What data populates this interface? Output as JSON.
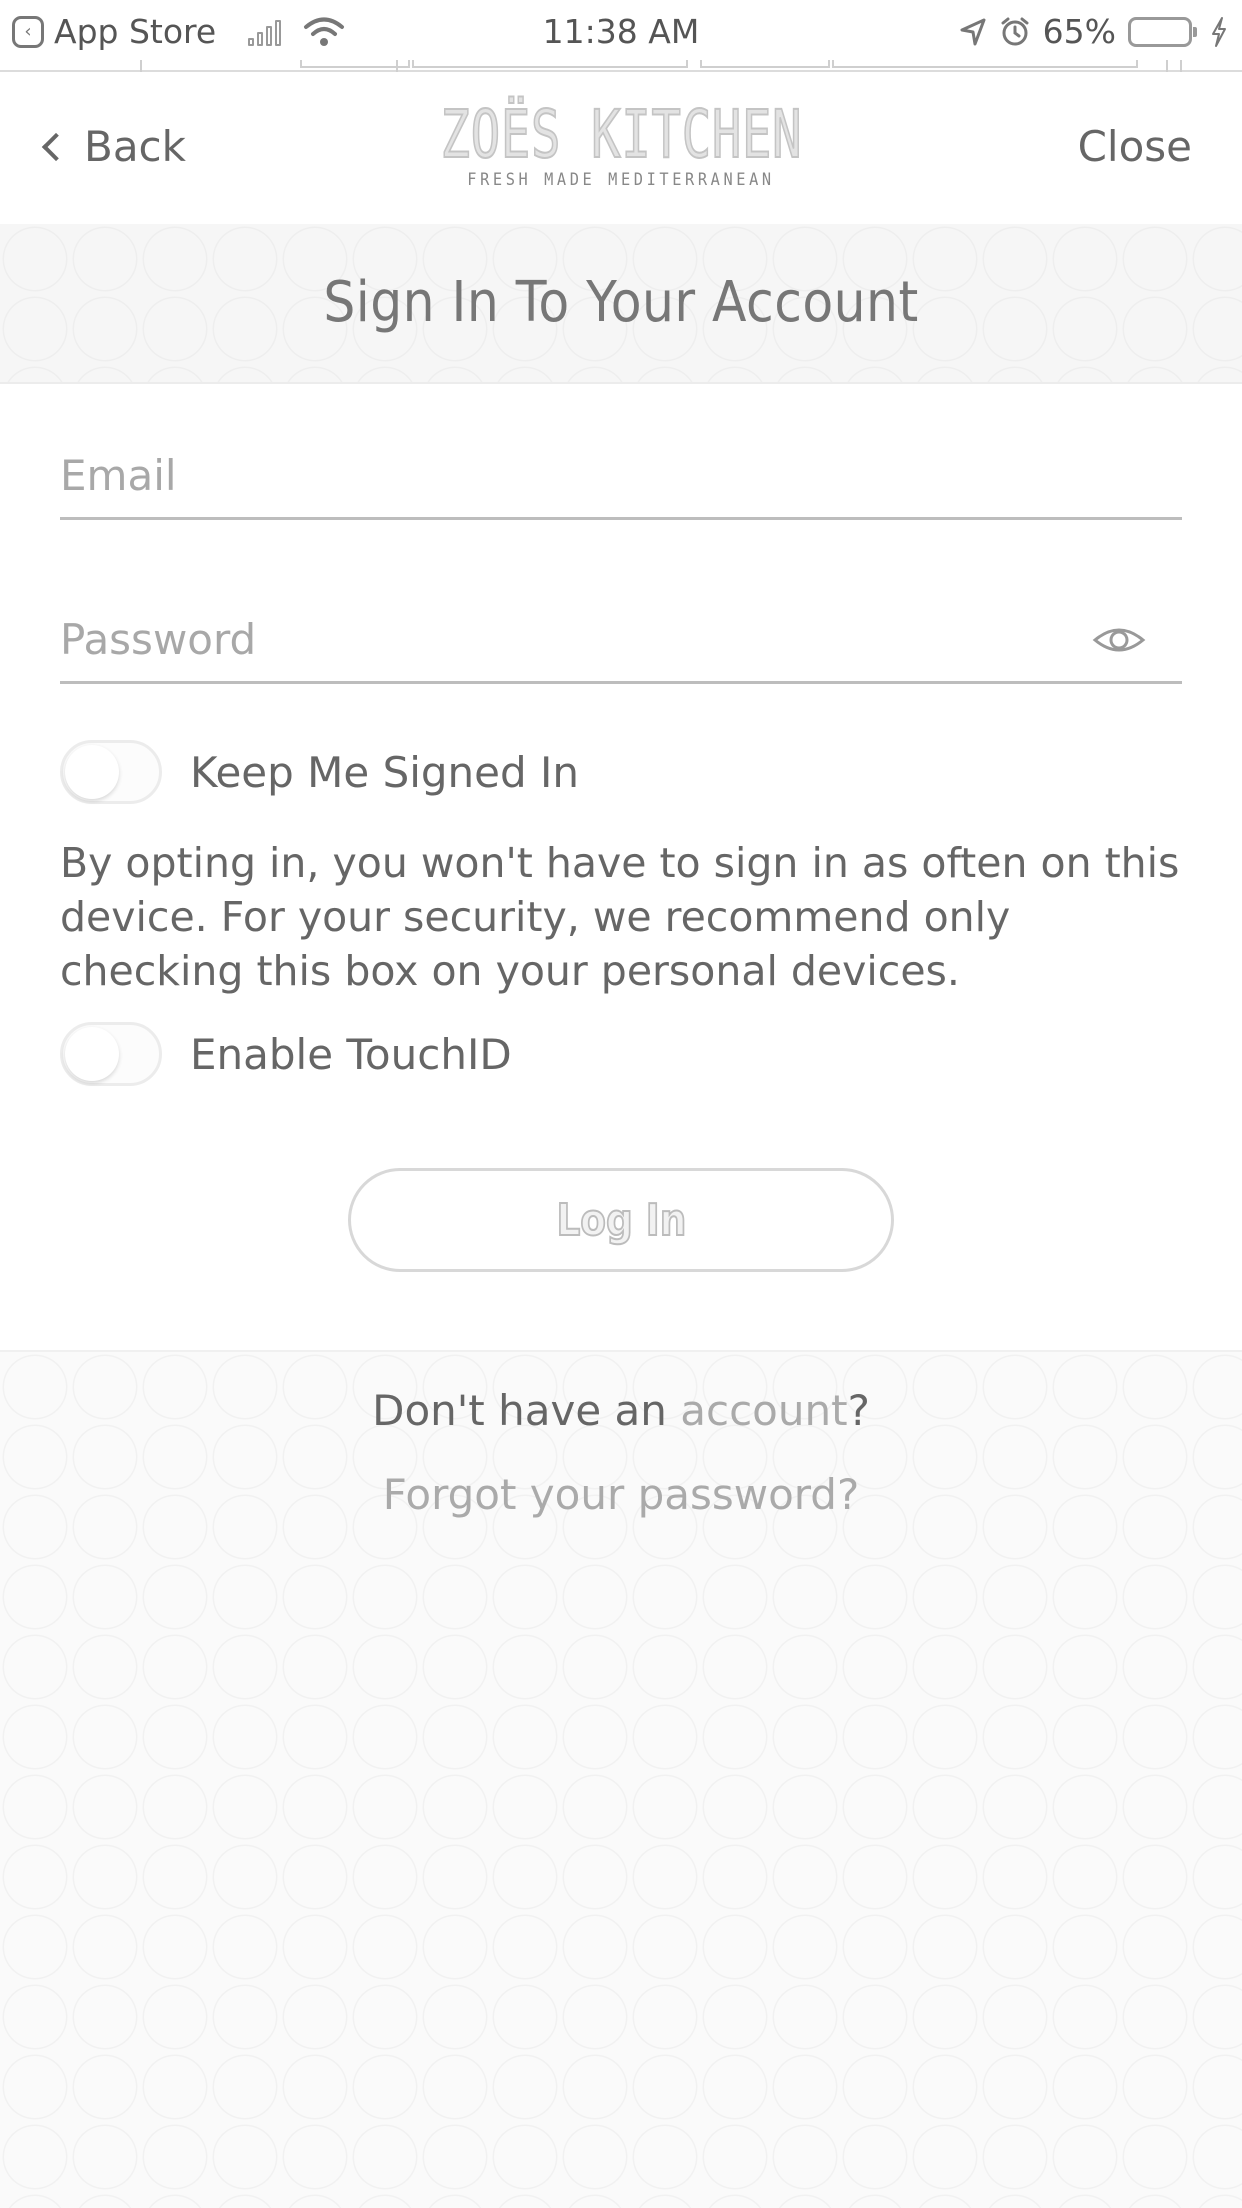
{
  "status_bar": {
    "back_app": "App Store",
    "time": "11:38 AM",
    "battery": "65%"
  },
  "nav": {
    "back_label": "Back",
    "close_label": "Close",
    "logo_name": "ZOËS KITCHEN",
    "logo_tagline": "FRESH MADE MEDITERRANEAN"
  },
  "title": "Sign In To Your Account",
  "form": {
    "email_placeholder": "Email",
    "email_value": "",
    "password_placeholder": "Password",
    "password_value": "",
    "keep_signed_in": {
      "label": "Keep Me Signed In",
      "on": false
    },
    "opt_in_note": "By opting in, you won't have to sign in as often on this device. For your security, we recommend only checking this box on your personal devices.",
    "touch_id": {
      "label": "Enable TouchID",
      "on": false
    },
    "login_label": "Log In"
  },
  "footer": {
    "signup_prefix": "Don't have an ",
    "signup_link": "account",
    "signup_suffix": "?",
    "forgot_label": "Forgot your password?"
  },
  "icons": {
    "back_app": "back-to-app-icon",
    "signal": "cellular-signal-icon",
    "wifi": "wifi-icon",
    "location": "location-arrow-icon",
    "alarm": "alarm-clock-icon",
    "battery": "battery-icon",
    "charging": "charging-bolt-icon",
    "nav_back": "chevron-left-icon",
    "password_visibility": "eye-icon"
  },
  "colors": {
    "text": "#666666",
    "link_muted": "#aaaaaa",
    "field_line": "#bdbdbd",
    "pattern_bg": "#f6f6f6"
  }
}
